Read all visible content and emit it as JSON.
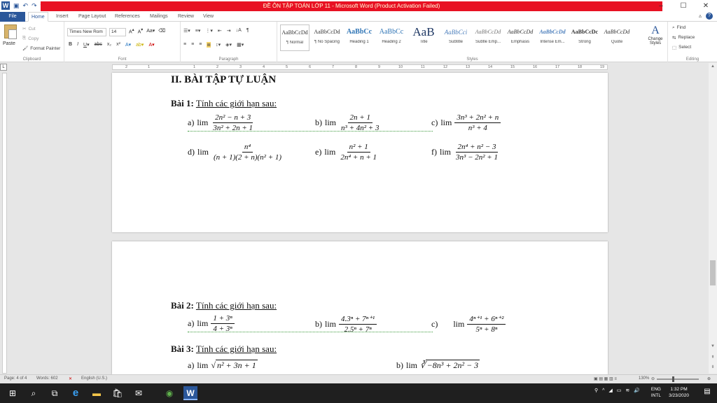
{
  "window": {
    "title": "ĐỀ ÔN TẬP TOÁN LỚP 11 - Microsoft Word (Product Activation Failed)",
    "minimize": "–",
    "maximize": "☐",
    "close": "✕"
  },
  "tabs": [
    "File",
    "Home",
    "Insert",
    "Page Layout",
    "References",
    "Mailings",
    "Review",
    "View"
  ],
  "ribbon": {
    "clipboard": {
      "paste": "Paste",
      "cut": "Cut",
      "copy": "Copy",
      "format_painter": "Format Painter",
      "label": "Clipboard"
    },
    "font": {
      "name": "Times New Rom",
      "size": "14",
      "label": "Font"
    },
    "paragraph": {
      "label": "Paragraph"
    },
    "styles": {
      "label": "Styles",
      "items": [
        {
          "preview": "AaBbCcDd",
          "name": "¶ Normal"
        },
        {
          "preview": "AaBbCcDd",
          "name": "¶ No Spacing"
        },
        {
          "preview": "AaBbCc",
          "name": "Heading 1"
        },
        {
          "preview": "AaBbCc",
          "name": "Heading 2"
        },
        {
          "preview": "AaB",
          "name": "Title"
        },
        {
          "preview": "AaBbCci",
          "name": "Subtitle"
        },
        {
          "preview": "AaBbCcDd",
          "name": "Subtle Emp..."
        },
        {
          "preview": "AaBbCcDd",
          "name": "Emphasis"
        },
        {
          "preview": "AaBbCcDd",
          "name": "Intense Em..."
        },
        {
          "preview": "AaBbCcDc",
          "name": "Strong"
        },
        {
          "preview": "AaBbCcDd",
          "name": "Quote"
        }
      ],
      "change_styles": "Change Styles"
    },
    "editing": {
      "find": "Find",
      "replace": "Replace",
      "select": "Select",
      "label": "Editing"
    }
  },
  "ruler": {
    "numbers": [
      "2",
      "1",
      "1",
      "2",
      "3",
      "4",
      "5",
      "6",
      "7",
      "8",
      "9",
      "10",
      "11",
      "12",
      "13",
      "14",
      "15",
      "16",
      "17",
      "18",
      "19"
    ]
  },
  "doc": {
    "heading": "II. BÀI TẬP TỰ LUẬN",
    "bai1": {
      "label": "Bài 1:",
      "text": "Tính các giới hạn sau:"
    },
    "bai1_items": [
      {
        "lbl": "a)",
        "num": "2n² − n + 3",
        "den": "3n² + 2n + 1"
      },
      {
        "lbl": "b)",
        "num": "2n + 1",
        "den": "n³ + 4n² + 3"
      },
      {
        "lbl": "c)",
        "num": "3n³ + 2n² + n",
        "den": "n³ + 4"
      },
      {
        "lbl": "d)",
        "num": "n⁴",
        "den": "(n + 1)(2 + n)(n² + 1)"
      },
      {
        "lbl": "e)",
        "num": "n² + 1",
        "den": "2n⁴ + n + 1"
      },
      {
        "lbl": "f)",
        "num": "2n⁴ + n² − 3",
        "den": "3n³ − 2n² + 1"
      }
    ],
    "bai2": {
      "label": "Bài 2:",
      "text": "Tính các giới hạn sau:"
    },
    "bai2_items": [
      {
        "lbl": "a)",
        "num": "1 + 3ⁿ",
        "den": "4 + 3ⁿ"
      },
      {
        "lbl": "b)",
        "num": "4.3ⁿ + 7ⁿ⁺¹",
        "den": "2.5ⁿ + 7ⁿ"
      },
      {
        "lbl": "c)",
        "num": "4ⁿ⁺¹ + 6ⁿ⁺²",
        "den": "5ⁿ + 8ⁿ"
      }
    ],
    "bai3": {
      "label": "Bài 3:",
      "text": "Tính các giới hạn sau:"
    },
    "bai3_items": [
      {
        "lbl": "a)",
        "rad": "n² + 3n + 1",
        "root": "√"
      },
      {
        "lbl": "b)",
        "rad": "−8n³ + 2n² − 3",
        "root": "∛"
      }
    ],
    "lim": "lim"
  },
  "status": {
    "page": "Page: 4 of 4",
    "words": "Words: 602",
    "lang": "English (U.S.)",
    "zoom": "130%"
  },
  "taskbar": {
    "lang1": "ENG",
    "lang2": "INTL",
    "time": "1:32 PM",
    "date": "3/23/2020"
  }
}
